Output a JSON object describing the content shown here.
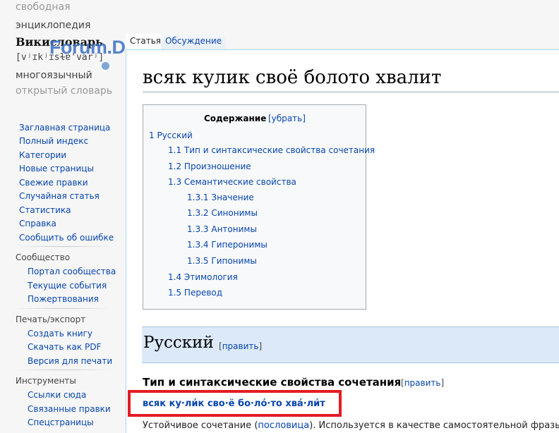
{
  "logo": {
    "line1": "свободная",
    "line2": "энциклопедия",
    "line3": "Викисловарь",
    "line4": "[vʲɪkʲɪsɫɐ'varʲ]",
    "line5": "многоязычный",
    "line6": "открытый словарь"
  },
  "watermark": "Forum.Domik.ua",
  "watermark_dots": [
    "#7ba7d6",
    "#dede9a",
    "#e08aa6"
  ],
  "tabs": {
    "article": "Статья",
    "discussion": "Обсуждение"
  },
  "nav": [
    "Заглавная страница",
    "Полный индекс",
    "Категории",
    "Новые страницы",
    "Свежие правки",
    "Случайная статья",
    "Статистика",
    "Справка",
    "Сообщить об ошибке"
  ],
  "community": {
    "title": "Сообщество",
    "items": [
      "Портал сообщества",
      "Текущие события",
      "Пожертвования"
    ]
  },
  "print": {
    "title": "Печать/экспорт",
    "items": [
      "Создать книгу",
      "Скачать как PDF",
      "Версия для печати"
    ]
  },
  "tools": {
    "title": "Инструменты",
    "items": [
      "Ссылки сюда",
      "Связанные правки",
      "Спецстраницы"
    ]
  },
  "page_title": "всяк кулик своё болото хвалит",
  "toc": {
    "title": "Содержание",
    "toggle": "[убрать]",
    "items": [
      {
        "num": "1",
        "label": "Русский"
      },
      {
        "num": "1.1",
        "label": "Тип и синтаксические свойства сочетания"
      },
      {
        "num": "1.2",
        "label": "Произношение"
      },
      {
        "num": "1.3",
        "label": "Семантические свойства"
      },
      {
        "num": "1.3.1",
        "label": "Значение"
      },
      {
        "num": "1.3.2",
        "label": "Синонимы"
      },
      {
        "num": "1.3.3",
        "label": "Антонимы"
      },
      {
        "num": "1.3.4",
        "label": "Гиперонимы"
      },
      {
        "num": "1.3.5",
        "label": "Гипонимы"
      },
      {
        "num": "1.4",
        "label": "Этимология"
      },
      {
        "num": "1.5",
        "label": "Перевод"
      }
    ]
  },
  "section": {
    "heading": "Русский",
    "edit": "править"
  },
  "subsection": {
    "heading": "Тип и синтаксические свойства сочетания",
    "edit": "править"
  },
  "hyphenation": "всяк ку·ли́к сво·ё бо·ло́·то хва́·ли́т",
  "paragraph": {
    "before": "Устойчивое сочетание (",
    "link": "пословица",
    "after": "). Используется в качестве самостоятельной фразы."
  }
}
